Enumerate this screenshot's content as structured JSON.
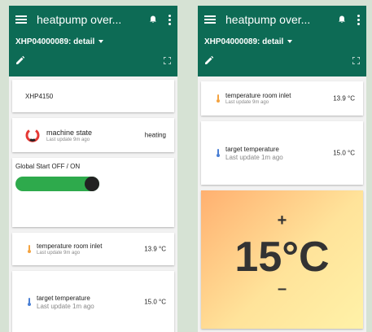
{
  "app": {
    "title": "heatpump over...",
    "device": "XHP04000089: detail"
  },
  "left": {
    "name_card": {
      "label": "XHP4150"
    },
    "state_card": {
      "label": "machine state",
      "updated": "Last update 9m ago",
      "value": "heating"
    },
    "global_card": {
      "label": "Global Start OFF / ON",
      "toggle": "on"
    },
    "temp_inlet": {
      "label": "temperature room inlet",
      "updated": "Last update 9m ago",
      "value": "13.9 °C"
    },
    "target": {
      "label": "target temperature",
      "updated": "Last update 1m ago",
      "value": "15.0 °C"
    }
  },
  "right": {
    "temp_inlet": {
      "label": "temperature room inlet",
      "updated": "Last update 9m ago",
      "value": "13.9 °C"
    },
    "target": {
      "label": "target temperature",
      "updated": "Last update 1m ago",
      "value": "15.0 °C"
    },
    "setpoint": {
      "plus": "+",
      "value": "15°C",
      "minus": "–"
    }
  },
  "colors": {
    "appbar": "#0d6b55",
    "toggle_on": "#2eaa4c",
    "state_icon": "#e53935"
  },
  "icons": [
    "menu-icon",
    "bell-icon",
    "more-vert-icon",
    "pencil-icon",
    "fullscreen-icon",
    "power-icon",
    "thermometer-icon"
  ]
}
